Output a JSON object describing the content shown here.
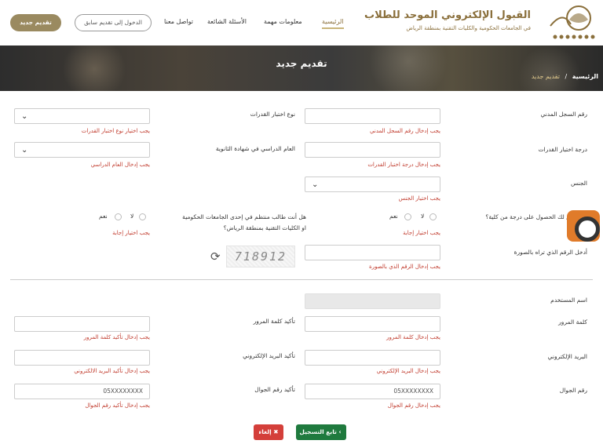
{
  "header": {
    "brand_title": "القبول الإلكتروني الموحد للطلاب",
    "brand_subtitle": "في الجامعات الحكومية والكليات التقنية بمنطقة الرياض",
    "nav": [
      "الرئيسية",
      "معلومات مهمة",
      "الأسئلة الشائعة",
      "تواصل معنا"
    ],
    "login_button": "الدخول إلى تقديم سابق",
    "apply_button": "تقديم جديد"
  },
  "banner": {
    "title": "تقديم جديد",
    "breadcrumb_home": "الرئيسية",
    "breadcrumb_sep": "/",
    "breadcrumb_current": "تقديم جديد"
  },
  "form": {
    "civil_id_label": "رقم السجل المدني",
    "civil_id_error": "يجب إدخال رقم السجل المدني",
    "aptitude_type_label": "نوع اختبار القدرات",
    "aptitude_type_error": "يجب اختيار نوع اختبار القدرات",
    "aptitude_score_label": "درجة اختبار القدرات",
    "aptitude_score_error": "يجب إدخال درجة اختبار القدرات",
    "school_year_label": "العام الدراسي في شهادة الثانوية",
    "school_year_error": "يجب إدخال العام الدراسي",
    "gender_label": "الجنس",
    "gender_error": "يجب اختيار الجنس",
    "prev_college_label": "هل سبق لك الحصول على درجة من كلية؟",
    "prev_college_no": "لا",
    "prev_college_yes": "نعم",
    "prev_college_error": "يجب اختيار إجابة",
    "enrolled_label_line1": "هل أنت طالب منتظم في إحدى الجامعات الحكومية",
    "enrolled_label_line2": "او الكليات التقنية بمنطقة الرياض؟",
    "enrolled_no": "لا",
    "enrolled_yes": "نعم",
    "enrolled_error": "يجب اختيار إجابة",
    "captcha_label": "أدخل الرقم الذي تراه بالصورة",
    "captcha_error": "يجب إدخال الرقم الذي بالصورة",
    "captcha_value": "718912",
    "username_label": "اسم المستخدم",
    "password_label": "كلمة المرور",
    "password_error": "يجب إدخال كلمة المرور",
    "password_confirm_label": "تأكيد كلمة المرور",
    "password_confirm_error": "يجب إدخال تأكيد كلمة المرور",
    "email_label": "البريد الإلكتروني",
    "email_error": "يجب إدخال البريد الإلكتروني",
    "email_confirm_label": "تأكيد البريد الإلكتروني",
    "email_confirm_error": "يجب إدخال تأكيد البريد الالكتروني",
    "mobile_label": "رقم الجوال",
    "mobile_placeholder": "05XXXXXXXX",
    "mobile_error": "يجب إدخال رقم الجوال",
    "mobile_confirm_label": "تأكيد رقم الجوال",
    "mobile_confirm_placeholder": "05XXXXXXXX",
    "mobile_confirm_error": "يجب إدخال تأكيد رقم الجوال",
    "next_button": "تابع التسجيل",
    "cancel_button": "إلغاء"
  }
}
